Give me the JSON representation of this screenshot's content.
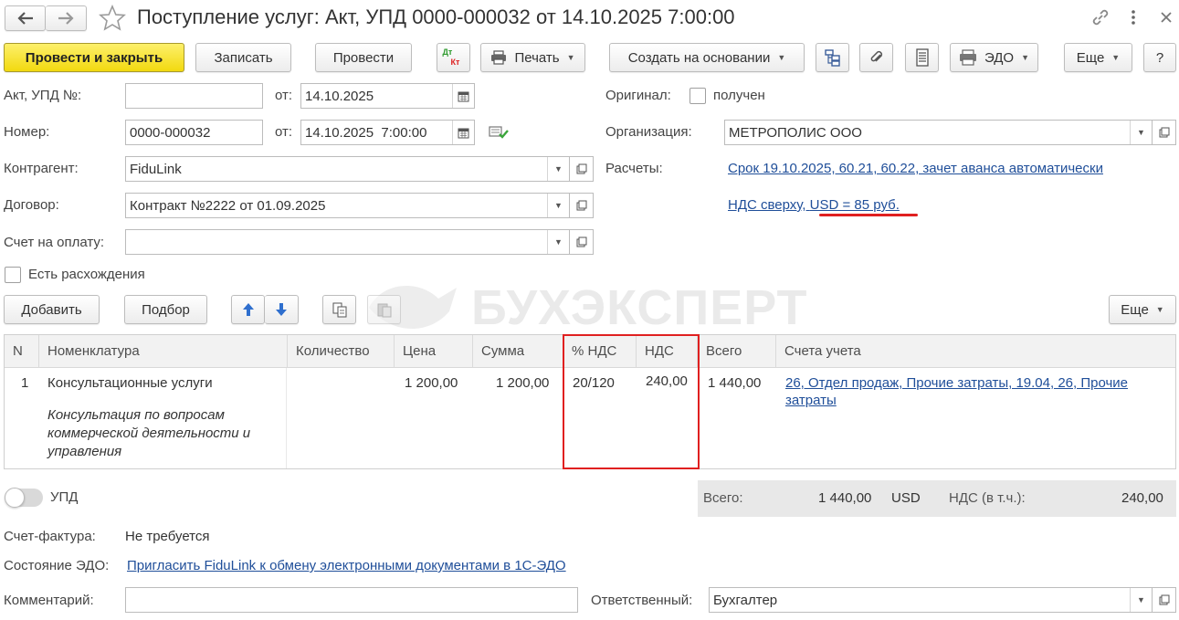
{
  "window": {
    "title": "Поступление услуг: Акт, УПД 0000-000032 от 14.10.2025 7:00:00"
  },
  "toolbar": {
    "post_close": "Провести и закрыть",
    "save": "Записать",
    "post": "Провести",
    "dtkt_top": "Дт",
    "dtkt_bottom": "Кт",
    "print": "Печать",
    "create_based": "Создать на основании",
    "edo": "ЭДО",
    "more": "Еще",
    "help": "?"
  },
  "form": {
    "act_label": "Акт, УПД №:",
    "act_value": "",
    "act_from_label": "от:",
    "act_date": "14.10.2025",
    "number_label": "Номер:",
    "number_value": "0000-000032",
    "number_from_label": "от:",
    "number_date": "14.10.2025  7:00:00",
    "contractor_label": "Контрагент:",
    "contractor_value": "FiduLink",
    "contract_label": "Договор:",
    "contract_value": "Контракт №2222 от 01.09.2025",
    "invoice_label": "Счет на оплату:",
    "invoice_value": "",
    "discrepancy_label": "Есть расхождения",
    "original_label": "Оригинал:",
    "original_check_label": "получен",
    "org_label": "Организация:",
    "org_value": "МЕТРОПОЛИС ООО",
    "settlements_label": "Расчеты:",
    "settlements_link": "Срок 19.10.2025, 60.21, 60.22, зачет аванса автоматически",
    "vat_link_a": "НДС сверху, ",
    "vat_link_b": "USD = 85 руб.",
    "vat_highlight_color": "#e02020"
  },
  "table_toolbar": {
    "add": "Добавить",
    "pick": "Подбор",
    "more": "Еще"
  },
  "watermark": "БУХЭКСПЕРТ",
  "table": {
    "headers": [
      "N",
      "Номенклатура",
      "Количество",
      "Цена",
      "Сумма",
      "% НДС",
      "НДС",
      "Всего",
      "Счета учета"
    ],
    "rows": [
      {
        "n": "1",
        "item": "Консультационные услуги",
        "note1": "Консультация по вопросам",
        "note2": "коммерческой деятельности и",
        "note3": "управления",
        "qty": "",
        "price": "1 200,00",
        "sum": "1 200,00",
        "vat_rate": "20/120",
        "vat": "240,00",
        "total": "1 440,00",
        "accounts1": "26, Отдел продаж, Прочие затраты, 19.04, 26, Прочие",
        "accounts2": "затраты"
      }
    ],
    "highlight_color": "#e02020"
  },
  "footer": {
    "upd_label": "УПД",
    "total_label": "Всего:",
    "total_value": "1 440,00",
    "currency": "USD",
    "vat_label": "НДС (в т.ч.):",
    "vat_value": "240,00",
    "invoice_label": "Счет-фактура:",
    "invoice_value": "Не требуется",
    "edo_label": "Состояние ЭДО:",
    "edo_link": "Пригласить FiduLink к обмену электронными документами в 1С-ЭДО",
    "comment_label": "Комментарий:",
    "comment_value": "",
    "responsible_label": "Ответственный:",
    "responsible_value": "Бухгалтер"
  },
  "colors": {
    "link": "#1f4e99",
    "primary_button": "#f6e02a",
    "red_annotation": "#e02020"
  }
}
